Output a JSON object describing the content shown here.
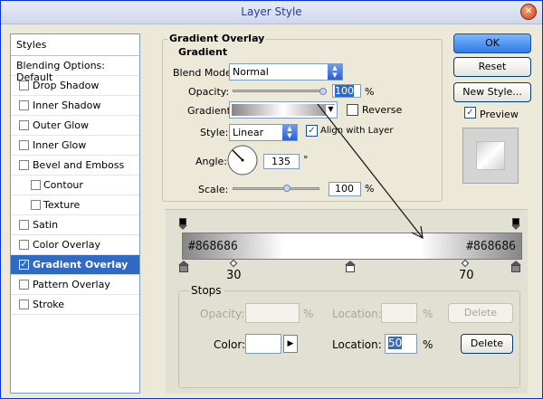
{
  "window": {
    "title": "Layer Style",
    "close_glyph": "✕"
  },
  "sidebar": {
    "header": "Styles",
    "items": [
      {
        "label": "Blending Options: Default",
        "checkbox": false,
        "checked": false
      },
      {
        "label": "Drop Shadow",
        "checkbox": true,
        "checked": false
      },
      {
        "label": "Inner Shadow",
        "checkbox": true,
        "checked": false
      },
      {
        "label": "Outer Glow",
        "checkbox": true,
        "checked": false
      },
      {
        "label": "Inner Glow",
        "checkbox": true,
        "checked": false
      },
      {
        "label": "Bevel and Emboss",
        "checkbox": true,
        "checked": false
      },
      {
        "label": "Contour",
        "checkbox": true,
        "checked": false,
        "sub": true
      },
      {
        "label": "Texture",
        "checkbox": true,
        "checked": false,
        "sub": true
      },
      {
        "label": "Satin",
        "checkbox": true,
        "checked": false
      },
      {
        "label": "Color Overlay",
        "checkbox": true,
        "checked": false
      },
      {
        "label": "Gradient Overlay",
        "checkbox": true,
        "checked": true,
        "selected": true
      },
      {
        "label": "Pattern Overlay",
        "checkbox": true,
        "checked": false
      },
      {
        "label": "Stroke",
        "checkbox": true,
        "checked": false
      }
    ]
  },
  "panel": {
    "title": "Gradient Overlay",
    "group": "Gradient",
    "blend_mode_label": "Blend Mode:",
    "blend_mode_value": "Normal",
    "opacity_label": "Opacity:",
    "opacity_value": "100",
    "opacity_unit": "%",
    "opacity_level": 1.0,
    "gradient_label": "Gradient:",
    "reverse_label": "Reverse",
    "style_label": "Style:",
    "style_value": "Linear",
    "align_label": "Align with Layer",
    "angle_label": "Angle:",
    "angle_value": "135",
    "angle_unit": "°",
    "scale_label": "Scale:",
    "scale_value": "100",
    "scale_unit": "%"
  },
  "buttons": {
    "ok": "OK",
    "reset": "Reset",
    "new_style": "New Style...",
    "preview_label": "Preview"
  },
  "gradient_editor": {
    "left_color": "#868686",
    "right_color": "#868686",
    "midpoint_left": "30",
    "midpoint_right": "70",
    "stops_legend": "Stops",
    "opacity_label": "Opacity:",
    "opacity_unit": "%",
    "location_label_1": "Location:",
    "location_unit_1": "%",
    "delete_label_1": "Delete",
    "color_label": "Color:",
    "location_label_2": "Location:",
    "location_value": "50",
    "location_unit_2": "%",
    "delete_label_2": "Delete"
  }
}
